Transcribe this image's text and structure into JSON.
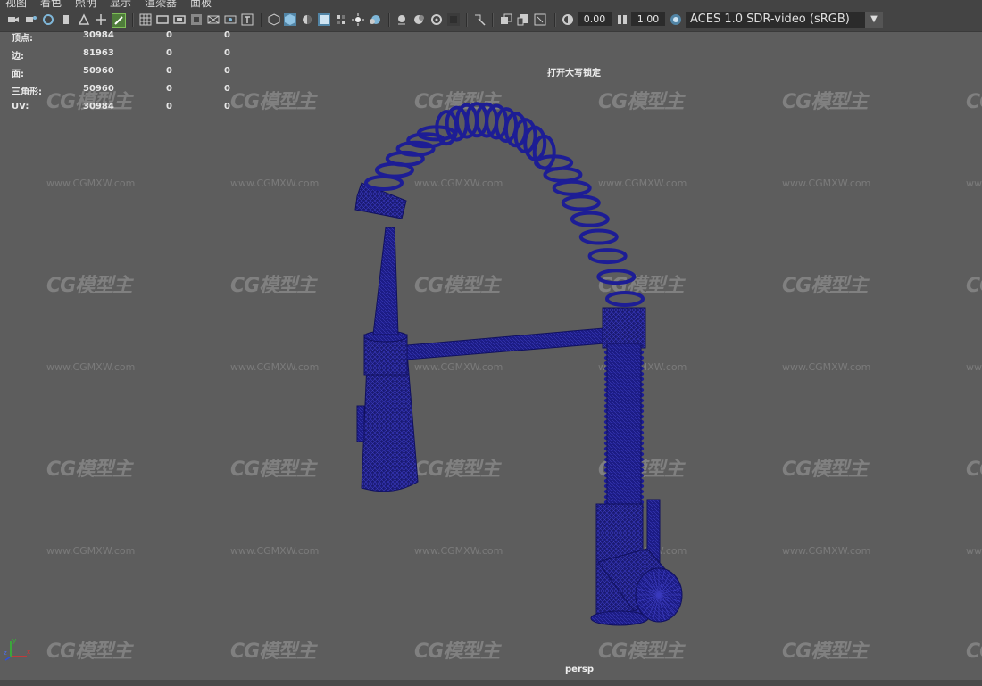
{
  "menubar": {
    "items": [
      "视图",
      "着色",
      "照明",
      "显示",
      "渲染器",
      "面板"
    ]
  },
  "toolbar": {
    "exposure_value": "0.00",
    "gamma_value": "1.00",
    "color_space": "ACES 1.0 SDR-video (sRGB)",
    "icons": [
      "camera-icon",
      "camera-attributes-icon",
      "bookmark-icon",
      "image-plane-icon",
      "transform-icon",
      "grease-pencil-icon",
      "grid-icon",
      "film-gate-icon",
      "resolution-gate-icon",
      "gate-mask-icon",
      "field-chart-icon",
      "safe-action-icon",
      "safe-title-icon",
      "wireframe-icon",
      "smooth-shade-icon",
      "default-material-icon",
      "textured-icon",
      "shadows-icon",
      "lights-icon",
      "ambient-occlusion-icon",
      "motion-blur-icon",
      "anti-aliasing-icon",
      "depth-of-field-icon",
      "isolate-select-icon",
      "xray-icon",
      "xray-joints-icon",
      "backface-icon",
      "exposure-icon",
      "gamma-icon",
      "color-management-icon"
    ],
    "accent_color": "#5285a6"
  },
  "hud": {
    "rows": [
      {
        "label": "顶点:",
        "v1": "30984",
        "v2": "0",
        "v3": "0"
      },
      {
        "label": "边:",
        "v1": "81963",
        "v2": "0",
        "v3": "0"
      },
      {
        "label": "面:",
        "v1": "50960",
        "v2": "0",
        "v3": "0"
      },
      {
        "label": "三角形:",
        "v1": "50960",
        "v2": "0",
        "v3": "0"
      },
      {
        "label": "UV:",
        "v1": "30984",
        "v2": "0",
        "v3": "0"
      }
    ],
    "capslock_message": "打开大写锁定",
    "camera": "persp"
  },
  "watermark": {
    "logo": "CG模型主",
    "url": "www.CGMXW.com"
  },
  "axis": {
    "x": "x",
    "y": "y",
    "z": "z"
  },
  "viewport": {
    "background_color": "#5d5d5d",
    "wireframe_color": "#1a1a8c"
  }
}
